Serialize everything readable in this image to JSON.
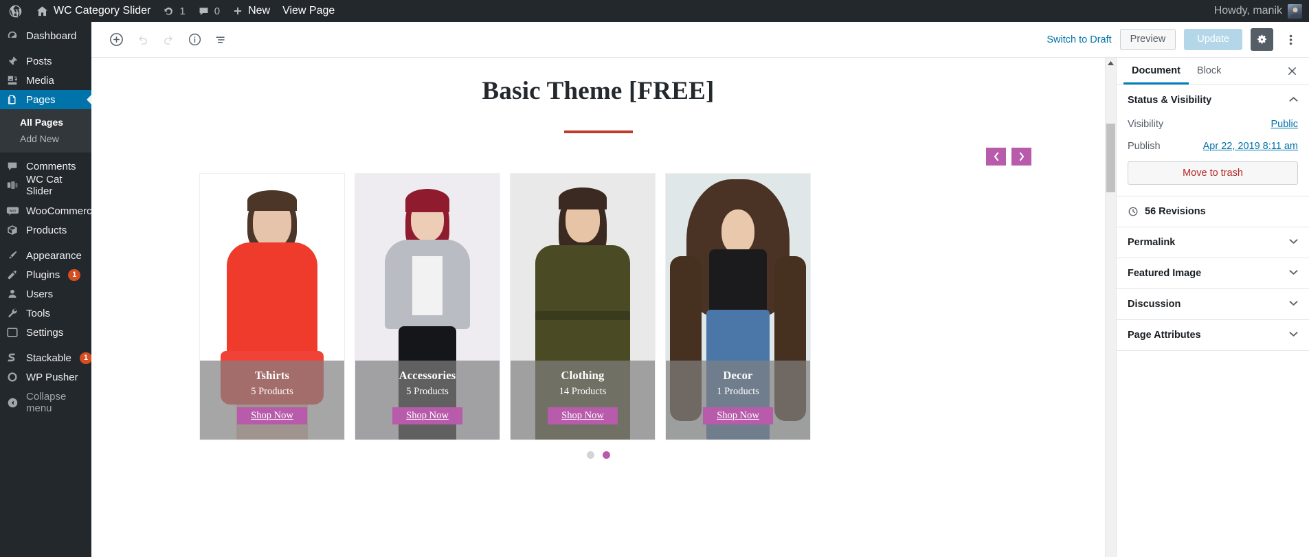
{
  "adminbar": {
    "site_name": "WC Category Slider",
    "updates_count": "1",
    "comments_count": "0",
    "new_label": "New",
    "view_page_label": "View Page",
    "howdy": "Howdy, manik"
  },
  "adminmenu": {
    "items": [
      {
        "label": "Dashboard",
        "icon": "dashboard-icon",
        "current": false
      },
      {
        "label": "Posts",
        "icon": "pin-icon",
        "current": false
      },
      {
        "label": "Media",
        "icon": "media-icon",
        "current": false
      },
      {
        "label": "Pages",
        "icon": "pages-icon",
        "current": true
      },
      {
        "label": "Comments",
        "icon": "comment-icon",
        "current": false
      },
      {
        "label": "WC Cat Slider",
        "icon": "slider-icon",
        "current": false
      },
      {
        "label": "WooCommerce",
        "icon": "woo-icon",
        "current": false
      },
      {
        "label": "Products",
        "icon": "products-icon",
        "current": false
      },
      {
        "label": "Appearance",
        "icon": "brush-icon",
        "current": false
      },
      {
        "label": "Plugins",
        "icon": "plug-icon",
        "current": false,
        "badge": "1"
      },
      {
        "label": "Users",
        "icon": "users-icon",
        "current": false
      },
      {
        "label": "Tools",
        "icon": "wrench-icon",
        "current": false
      },
      {
        "label": "Settings",
        "icon": "settings-icon",
        "current": false
      },
      {
        "label": "Stackable",
        "icon": "stackable-icon",
        "current": false,
        "badge": "1"
      },
      {
        "label": "WP Pusher",
        "icon": "circle-icon",
        "current": false
      }
    ],
    "submenu": [
      {
        "label": "All Pages",
        "current": true
      },
      {
        "label": "Add New",
        "current": false
      }
    ],
    "collapse_label": "Collapse menu"
  },
  "editor_header": {
    "add_block_label": "Add block",
    "undo_label": "Undo",
    "redo_label": "Redo",
    "info_label": "Content structure",
    "list_view_label": "Block navigation",
    "switch_to_draft": "Switch to Draft",
    "preview": "Preview",
    "update": "Update",
    "settings_label": "Settings",
    "more_label": "More tools & options"
  },
  "canvas": {
    "post_title": "Basic Theme [FREE]",
    "slider": {
      "prev_label": "‹",
      "next_label": "›",
      "shop_label": "Shop Now",
      "cards": [
        {
          "name": "Tshirts",
          "count": "5 Products",
          "bg": "#ffffff"
        },
        {
          "name": "Accessories",
          "count": "5 Products",
          "bg": "#eeecf0"
        },
        {
          "name": "Clothing",
          "count": "14 Products",
          "bg": "#e9e9e9"
        },
        {
          "name": "Decor",
          "count": "1 Products",
          "bg": "#dfe7e8"
        }
      ],
      "dots": [
        {
          "active": false
        },
        {
          "active": true
        }
      ]
    }
  },
  "sidebar": {
    "tabs": [
      {
        "label": "Document",
        "active": true
      },
      {
        "label": "Block",
        "active": false
      }
    ],
    "close_label": "×",
    "status_panel": {
      "title": "Status & Visibility",
      "visibility_label": "Visibility",
      "visibility_value": "Public",
      "publish_label": "Publish",
      "publish_value": "Apr 22, 2019 8:11 am",
      "trash_label": "Move to trash"
    },
    "revisions_label": "56 Revisions",
    "panels": [
      {
        "title": "Permalink"
      },
      {
        "title": "Featured Image"
      },
      {
        "title": "Discussion"
      },
      {
        "title": "Page Attributes"
      }
    ]
  },
  "colors": {
    "admin_dark": "#23282d",
    "admin_blue": "#0073aa",
    "accent_purple": "#b85bab",
    "title_rule_red": "#c0392b",
    "trash_red": "#b52727"
  }
}
